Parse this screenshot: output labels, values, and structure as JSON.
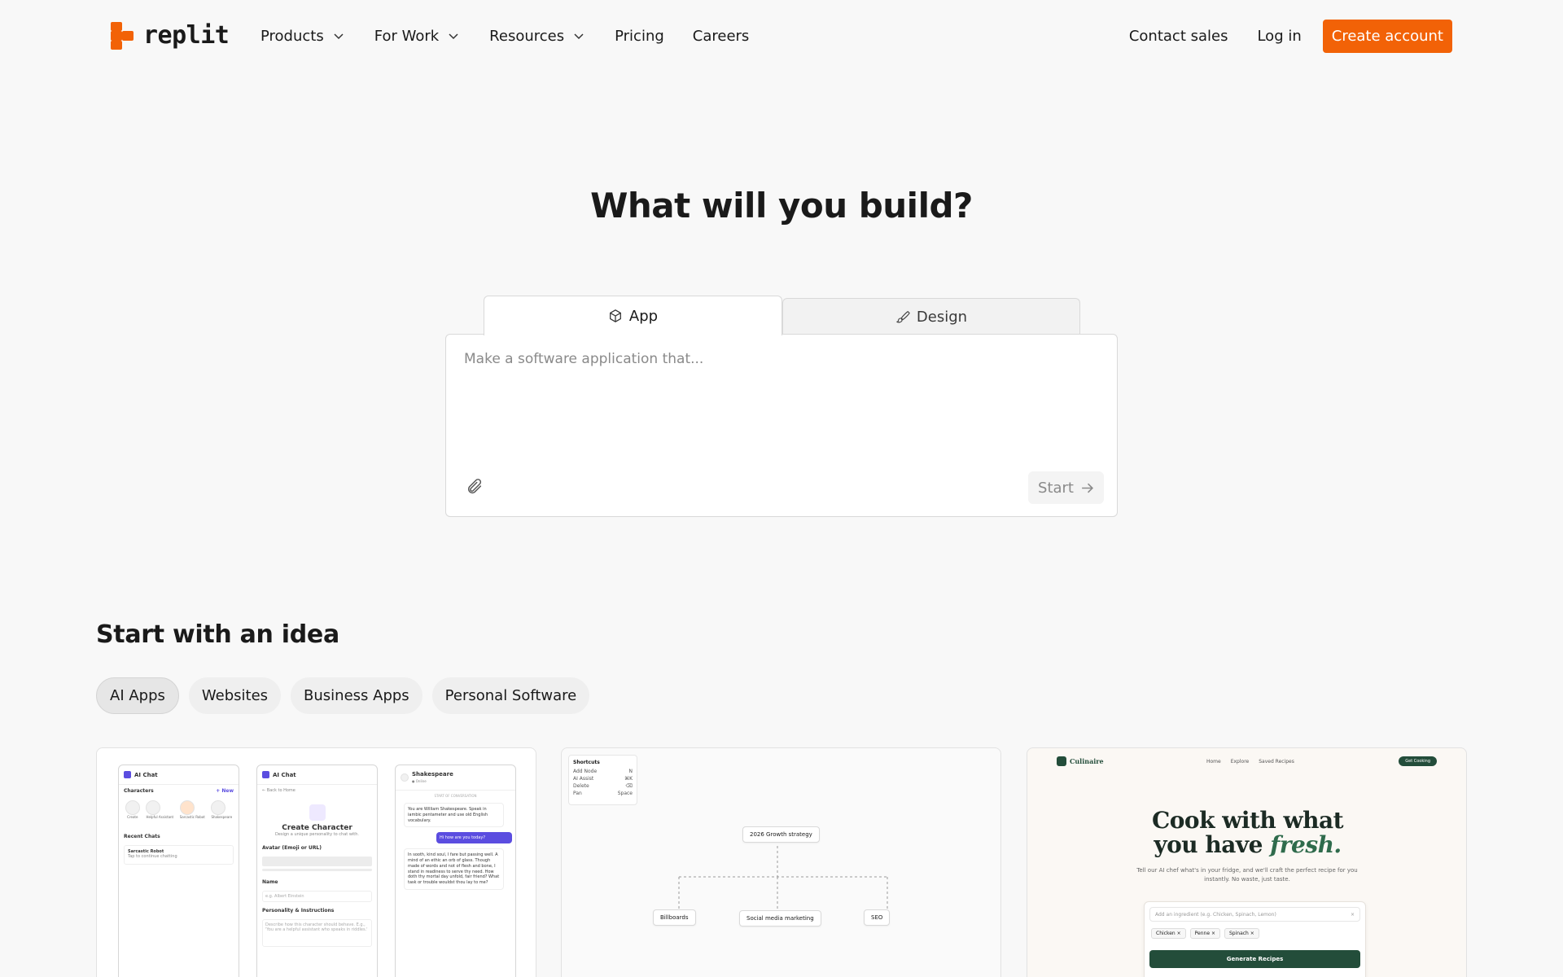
{
  "nav": {
    "logo_text": "replit",
    "links": [
      {
        "label": "Products",
        "dropdown": true
      },
      {
        "label": "For Work",
        "dropdown": true
      },
      {
        "label": "Resources",
        "dropdown": true
      },
      {
        "label": "Pricing",
        "dropdown": false
      },
      {
        "label": "Careers",
        "dropdown": false
      }
    ],
    "contact_sales": "Contact sales",
    "log_in": "Log in",
    "create_account": "Create account"
  },
  "colors": {
    "brand_orange": "#f26207",
    "recipe_green": "#234d3a",
    "chat_purple": "#5b4de0"
  },
  "hero": {
    "title": "What will you build?",
    "tabs": [
      {
        "label": "App",
        "icon": "cube-icon",
        "active": true
      },
      {
        "label": "Design",
        "icon": "brush-icon",
        "active": false
      }
    ],
    "prompt_placeholder": "Make a software application that...",
    "start_label": "Start"
  },
  "ideas": {
    "title": "Start with an idea",
    "chips": [
      "AI Apps",
      "Websites",
      "Business Apps",
      "Personal Software"
    ],
    "active_chip": "AI Apps"
  },
  "cards": {
    "chat": {
      "app_name": "AI Chat",
      "characters_label": "Characters",
      "new_label": "+ New",
      "character_names": [
        "Create",
        "Helpful Assistant",
        "Sarcastic Robot",
        "Shakespeare"
      ],
      "recent_chats_label": "Recent Chats",
      "recent_item": "Sarcastic Robot",
      "recent_item_sub": "Tap to continue chatting",
      "back_label": "← Back to Home",
      "create_title": "Create Character",
      "create_sub": "Design a unique personality to chat with.",
      "avatar_label": "Avatar (Emoji or URL)",
      "name_label": "Name",
      "name_placeholder": "e.g. Albert Einstein",
      "personality_label": "Personality & Instructions",
      "personality_placeholder": "Describe how this character should behave. E.g., 'You are a helpful assistant who speaks in riddles.'",
      "chat_name": "Shakespeare",
      "chat_status": "● Online",
      "start_conv": "START OF CONVERSATION",
      "msg_system": "You are William Shakespeare. Speak in iambic pentameter and use old English vocabulary.",
      "msg_user": "Hi how are you today?",
      "msg_reply": "In sooth, kind soul, I fare but passing well. A mind of an ethic an orb of glass. Though made of words and not of flesh and bone, I stand in readiness to serve thy need. How doth thy mortal day unfold, fair friend? What task or trouble wouldst thou lay to me?"
    },
    "mindmap": {
      "shortcuts_title": "Shortcuts",
      "shortcuts": [
        {
          "action": "Add Node",
          "key": "N"
        },
        {
          "action": "AI Assist",
          "key": "⌘K"
        },
        {
          "action": "Delete",
          "key": "⌫"
        },
        {
          "action": "Pan",
          "key": "Space"
        }
      ],
      "root": "2026 Growth strategy",
      "children": [
        "Billboards",
        "Social media marketing",
        "SEO"
      ]
    },
    "recipe": {
      "brand": "Culinaire",
      "nav_links": [
        "Home",
        "Explore",
        "Saved Recipes"
      ],
      "cta": "Get Cooking",
      "title_line1": "Cook with what",
      "title_line2_a": "you have ",
      "title_line2_b": "fresh.",
      "subtitle": "Tell our AI chef what's in your fridge, and we'll craft the perfect recipe for you instantly. No waste, just taste.",
      "input_placeholder": "Add an ingredient (e.g. Chicken, Spinach, Lemon)",
      "tags": [
        "Chicken ×",
        "Penne ×",
        "Spinach ×"
      ],
      "generate": "Generate Recipes"
    }
  }
}
